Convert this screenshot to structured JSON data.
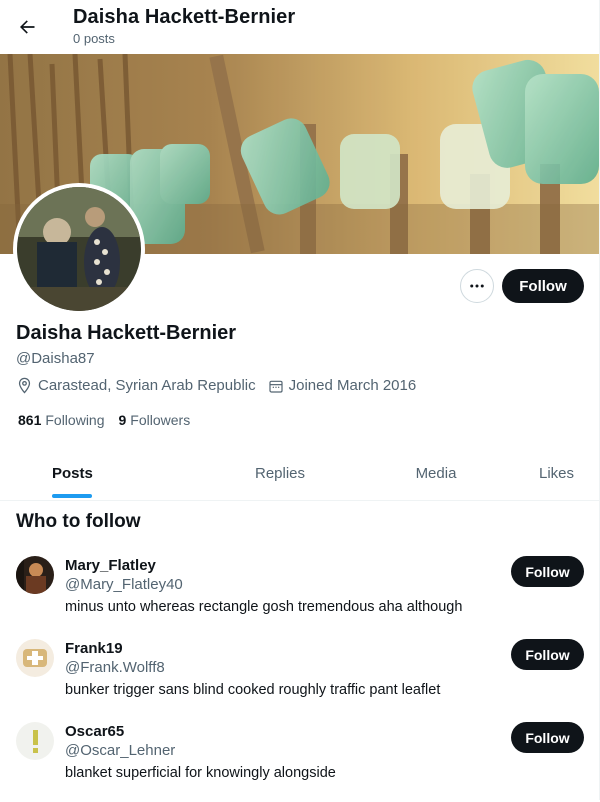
{
  "header": {
    "title": "Daisha Hackett-Bernier",
    "subtitle": "0 posts"
  },
  "profile": {
    "name": "Daisha Hackett-Bernier",
    "handle": "@Daisha87",
    "location": "Carastead, Syrian Arab Republic",
    "joined": "Joined March 2016",
    "following_count": "861",
    "following_label": "Following",
    "followers_count": "9",
    "followers_label": "Followers",
    "follow_label": "Follow"
  },
  "tabs": [
    {
      "label": "Posts",
      "active": true
    },
    {
      "label": "Replies",
      "active": false
    },
    {
      "label": "Media",
      "active": false
    },
    {
      "label": "Likes",
      "active": false
    }
  ],
  "who_to_follow": {
    "title": "Who to follow",
    "suggestions": [
      {
        "name": "Mary_Flatley",
        "handle": "@Mary_Flatley40",
        "bio": "minus unto whereas rectangle gosh tremendous aha although",
        "follow_label": "Follow"
      },
      {
        "name": "Frank19",
        "handle": "@Frank.Wolff8",
        "bio": "bunker trigger sans blind cooked roughly traffic pant leaflet",
        "follow_label": "Follow"
      },
      {
        "name": "Oscar65",
        "handle": "@Oscar_Lehner",
        "bio": "blanket superficial for knowingly alongside",
        "follow_label": "Follow"
      }
    ]
  },
  "icons": {
    "back": "arrow-left-icon",
    "more": "more-horizontal-icon",
    "location": "location-pin-icon",
    "calendar": "calendar-icon"
  },
  "colors": {
    "accent": "#1d9bf0",
    "button": "#0f1419",
    "muted": "#536471"
  }
}
